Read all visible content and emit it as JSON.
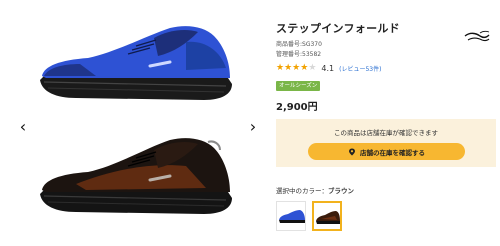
{
  "gallery": {
    "prev_icon": "chevron-left-icon",
    "next_icon": "chevron-right-icon",
    "prev_glyph": "‹",
    "next_glyph": "›",
    "images": [
      {
        "name": "product-image-blue",
        "color": "#2e52d4"
      },
      {
        "name": "product-image-brown",
        "color": "#5a2a12"
      }
    ]
  },
  "product": {
    "title": "ステップインフォールド",
    "code_line1": "商品番号:SG370",
    "code_line2": "管理番号:53582",
    "rating": {
      "score": 4.1,
      "score_text": "4.1",
      "stars_filled": 4,
      "stars_total": 5,
      "review_link": "(レビュー53件)"
    },
    "season_badge": "オールシーズン",
    "price": "2,900円"
  },
  "stock": {
    "note": "この商品は店舗在庫が確認できます",
    "button_label": "店舗の在庫を確認する",
    "button_icon": "map-pin-icon"
  },
  "color_select": {
    "label": "選択中のカラー：",
    "selected": "ブラウン",
    "swatches": [
      {
        "name": "swatch-blue",
        "color": "#2e52d4",
        "selected": false
      },
      {
        "name": "swatch-brown",
        "color": "#3a1c0c",
        "selected": true
      }
    ]
  },
  "colors": {
    "accent": "#f7b731",
    "badge_green": "#7ab648",
    "stock_bg": "#fbf1dc",
    "star": "#f2a200",
    "link": "#2a6fd1"
  },
  "brand": {
    "logo_icon": "brand-logo-icon"
  }
}
